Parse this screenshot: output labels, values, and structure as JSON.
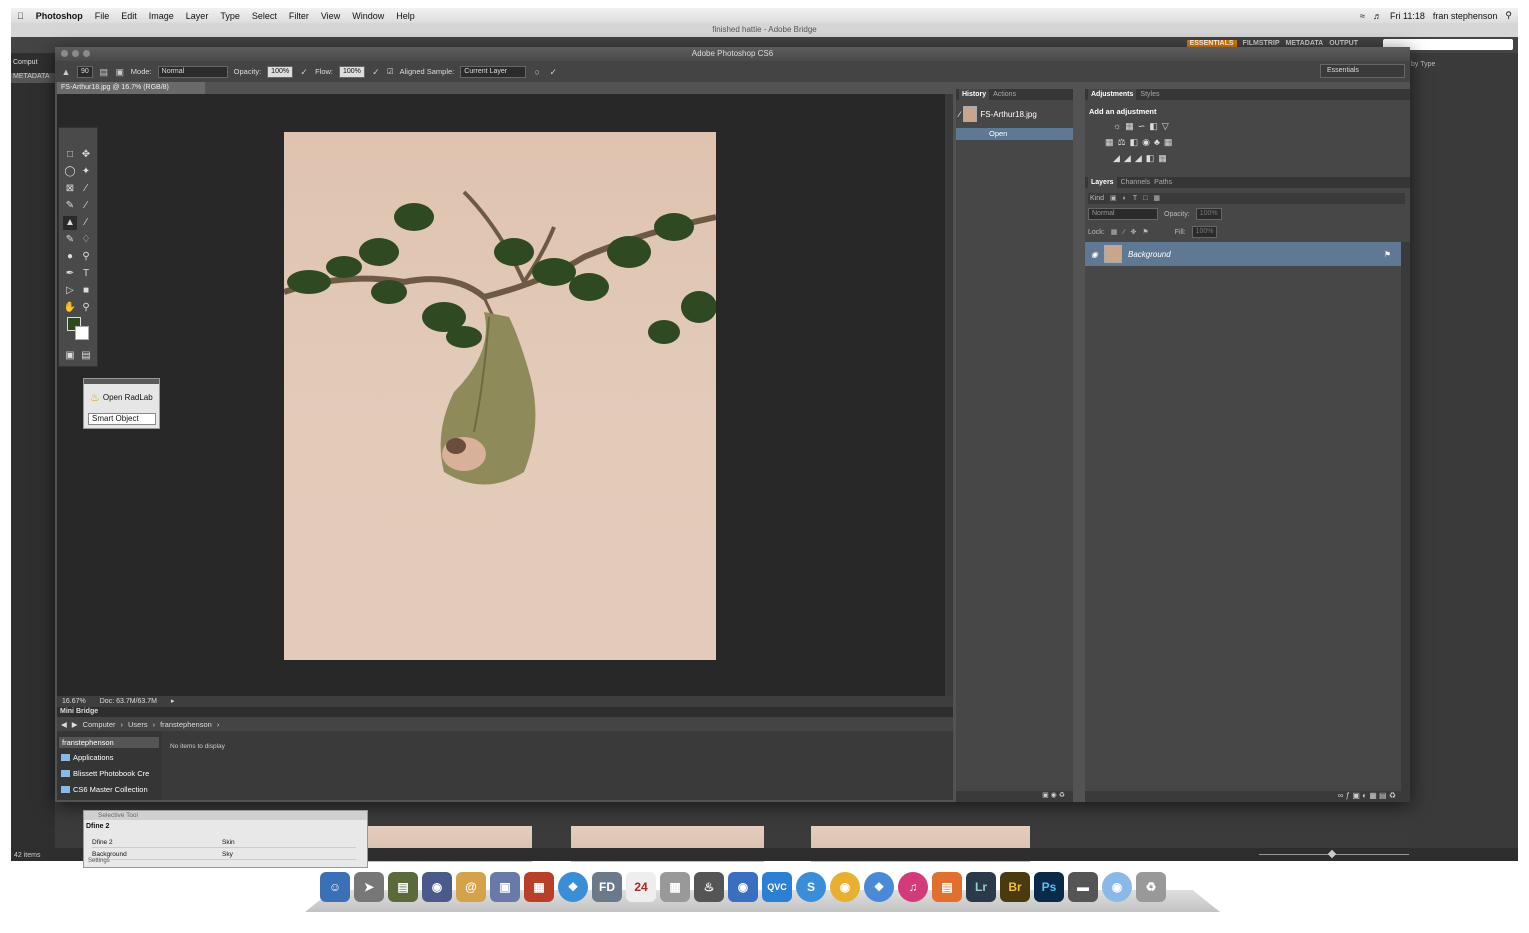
{
  "menubar": {
    "app": "Photoshop",
    "items": [
      "File",
      "Edit",
      "Image",
      "Layer",
      "Type",
      "Select",
      "Filter",
      "View",
      "Window",
      "Help"
    ],
    "status": "Fri 11:18",
    "user": "fran stephenson"
  },
  "bridge": {
    "title": "finished hattie - Adobe Bridge",
    "workspaces": [
      "ESSENTIALS",
      "FILMSTRIP",
      "METADATA",
      "OUTPUT"
    ],
    "left_tab": "Comput",
    "metadata_tab": "METADATA",
    "sort_label": "by Type",
    "items_count": "42 items"
  },
  "ps": {
    "title": "Adobe Photoshop CS6",
    "options": {
      "brush_size": "90",
      "mode_label": "Mode:",
      "mode_value": "Normal",
      "opacity_label": "Opacity:",
      "opacity_value": "100%",
      "flow_label": "Flow:",
      "flow_value": "100%",
      "aligned_label": "Aligned Sample:",
      "sample_value": "Current Layer"
    },
    "workspace": "Essentials",
    "doc_tab": "FS-Arthur18.jpg @ 16.7% (RGB/8)",
    "status": {
      "zoom": "16.67%",
      "doc": "Doc: 63.7M/63.7M"
    }
  },
  "radlab": {
    "button": "Open RadLab",
    "select": "Smart Object"
  },
  "mini_bridge": {
    "title": "Mini Bridge",
    "path": [
      "Computer",
      "Users",
      "franstephenson"
    ],
    "user": "franstephenson",
    "folders": [
      "Applications",
      "Blissett Photobook Cre",
      "CS6 Master Collection"
    ],
    "empty": "No items to display"
  },
  "history": {
    "tabs": [
      "History",
      "Actions"
    ],
    "snapshot": "FS-Arthur18.jpg",
    "step": "Open"
  },
  "adjustments": {
    "tabs": [
      "Adjustments",
      "Styles"
    ],
    "title": "Add an adjustment"
  },
  "layers": {
    "tabs": [
      "Layers",
      "Channels",
      "Paths"
    ],
    "kind": "Kind",
    "blend": "Normal",
    "opacity_label": "Opacity:",
    "opacity_value": "100%",
    "lock_label": "Lock:",
    "fill_label": "Fill:",
    "fill_value": "100%",
    "layer_name": "Background"
  },
  "selective_tool": {
    "title": "Selective Tool",
    "group": "Dfine 2",
    "rows": [
      {
        "a": "Dfine 2",
        "b": "Skin"
      },
      {
        "a": "Background",
        "b": "Sky"
      }
    ],
    "settings": "Settings"
  },
  "dock": {
    "lightroom": "Lr",
    "bridge": "Br",
    "photoshop": "Ps",
    "calendar_day": "24",
    "qvc": "QVC"
  }
}
